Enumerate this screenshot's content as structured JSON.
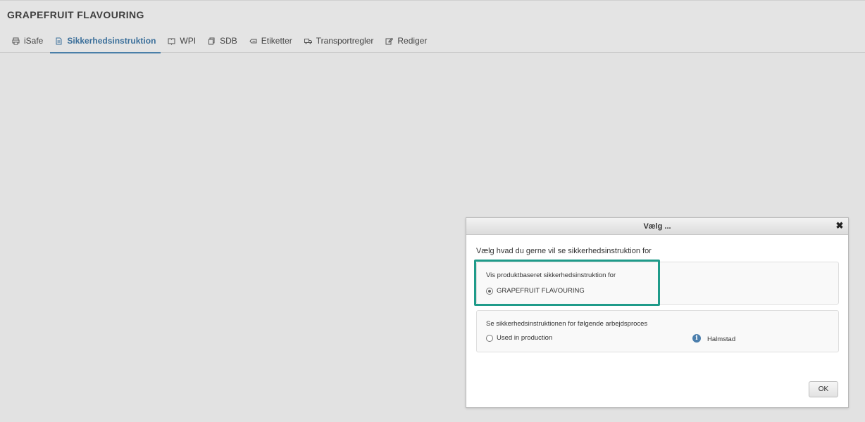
{
  "page": {
    "title": "GRAPEFRUIT FLAVOURING"
  },
  "tabs": [
    {
      "label": "iSafe",
      "icon": "printer-icon"
    },
    {
      "label": "Sikkerhedsinstruktion",
      "icon": "document-icon"
    },
    {
      "label": "WPI",
      "icon": "book-icon"
    },
    {
      "label": "SDB",
      "icon": "copy-icon"
    },
    {
      "label": "Etiketter",
      "icon": "label-icon"
    },
    {
      "label": "Transportregler",
      "icon": "truck-icon"
    },
    {
      "label": "Rediger",
      "icon": "edit-icon"
    }
  ],
  "active_tab": "Sikkerhedsinstruktion",
  "dialog": {
    "title": "Vælg ...",
    "intro": "Vælg hvad du gerne vil se sikkerhedsinstruktion for",
    "group1": {
      "heading": "Vis produktbaseret sikkerhedsinstruktion for",
      "option": "GRAPEFRUIT FLAVOURING",
      "selected": true
    },
    "group2": {
      "heading": "Se sikkerhedsinstruktionen for følgende arbejdsproces",
      "option": "Used in production",
      "selected": false,
      "location": "Halmstad"
    },
    "ok_label": "OK"
  },
  "colors": {
    "accent": "#3b6f9a",
    "highlight": "#1f9b8a",
    "info": "#4c7fad"
  }
}
